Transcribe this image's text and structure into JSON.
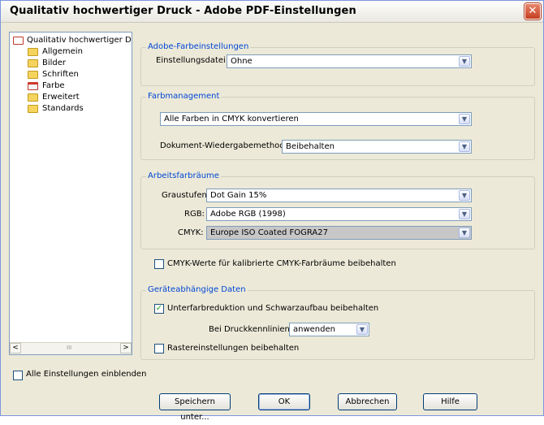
{
  "window": {
    "title": "Qualitativ hochwertiger Druck - Adobe PDF-Einstellungen",
    "close_glyph": "✕"
  },
  "tree": {
    "root": "Qualitativ hochwertiger Druc",
    "items": [
      "Allgemein",
      "Bilder",
      "Schriften",
      "Farbe",
      "Erweitert",
      "Standards"
    ],
    "scroll_left": "<",
    "scroll_right": ">",
    "grip": "III"
  },
  "color_settings": {
    "legend": "Adobe-Farbeinstellungen",
    "file_label": "Einstellungsdatei:",
    "file_value": "Ohne"
  },
  "color_management": {
    "legend": "Farbmanagement",
    "policy_value": "Alle Farben in CMYK konvertieren",
    "intent_label": "Dokument-Wiedergabemethode:",
    "intent_value": "Beibehalten"
  },
  "working_spaces": {
    "legend": "Arbeitsfarbräume",
    "gray_label": "Graustufen:",
    "gray_value": "Dot Gain 15%",
    "rgb_label": "RGB:",
    "rgb_value": "Adobe RGB (1998)",
    "cmyk_label": "CMYK:",
    "cmyk_value": "Europe ISO Coated FOGRA27"
  },
  "cmyk_preserve": {
    "label": "CMYK-Werte für kalibrierte CMYK-Farbräume beibehalten",
    "checked": false
  },
  "device_data": {
    "legend": "Geräteabhängige Daten",
    "ucr_label": "Unterfarbreduktion und Schwarzaufbau beibehalten",
    "ucr_checked": true,
    "transfer_label": "Bei Druckkennlinien:",
    "transfer_value": "anwenden",
    "halftone_label": "Rastereinstellungen beibehalten",
    "halftone_checked": false
  },
  "show_all": {
    "label": "Alle Einstellungen einblenden",
    "checked": false
  },
  "buttons": {
    "save_as": "Speichern unter...",
    "ok": "OK",
    "cancel": "Abbrechen",
    "help": "Hilfe"
  },
  "glyphs": {
    "arrow": "▼",
    "check": "✓"
  },
  "colors": {
    "legend": "#0046d5",
    "dialog_bg": "#ece9d8",
    "close": "#c43d1e"
  }
}
